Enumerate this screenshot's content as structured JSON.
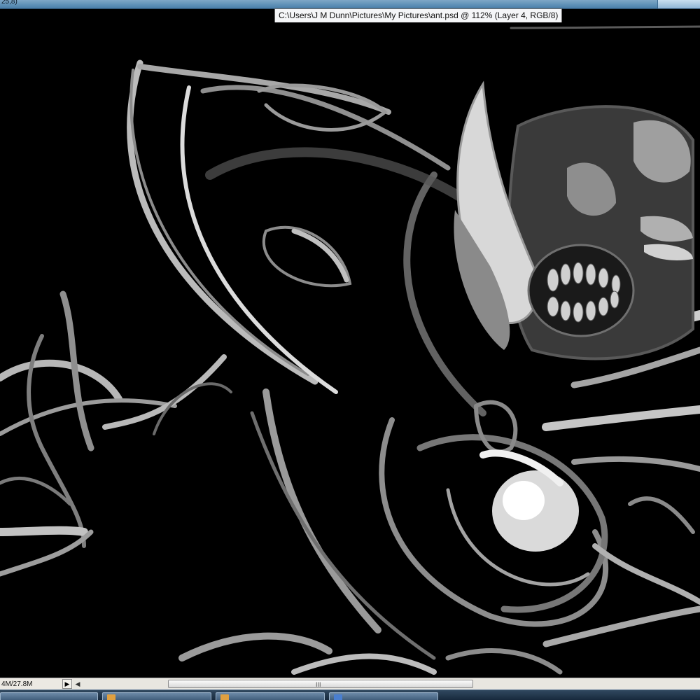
{
  "window": {
    "title_fragment": "25,8)",
    "document_title": "C:\\Users\\J M Dunn\\Pictures\\My Pictures\\ant.psd @ 112% (Layer 4, RGB/8)"
  },
  "status": {
    "doc_size": "4M/27.8M",
    "menu_arrow": "▶",
    "scroll_left_arrow": "◀",
    "scroll_grip": "III"
  },
  "taskbar": {
    "buttons": [
      {
        "icon": "app-icon"
      },
      {
        "icon": "app-icon"
      },
      {
        "icon": "app-icon"
      },
      {
        "icon": "app-icon"
      }
    ]
  },
  "colors": {
    "canvas": "#000000",
    "stroke_light": "#d9d9d9",
    "stroke_mid": "#8a8a8a",
    "stroke_dark": "#4d4d4d"
  }
}
